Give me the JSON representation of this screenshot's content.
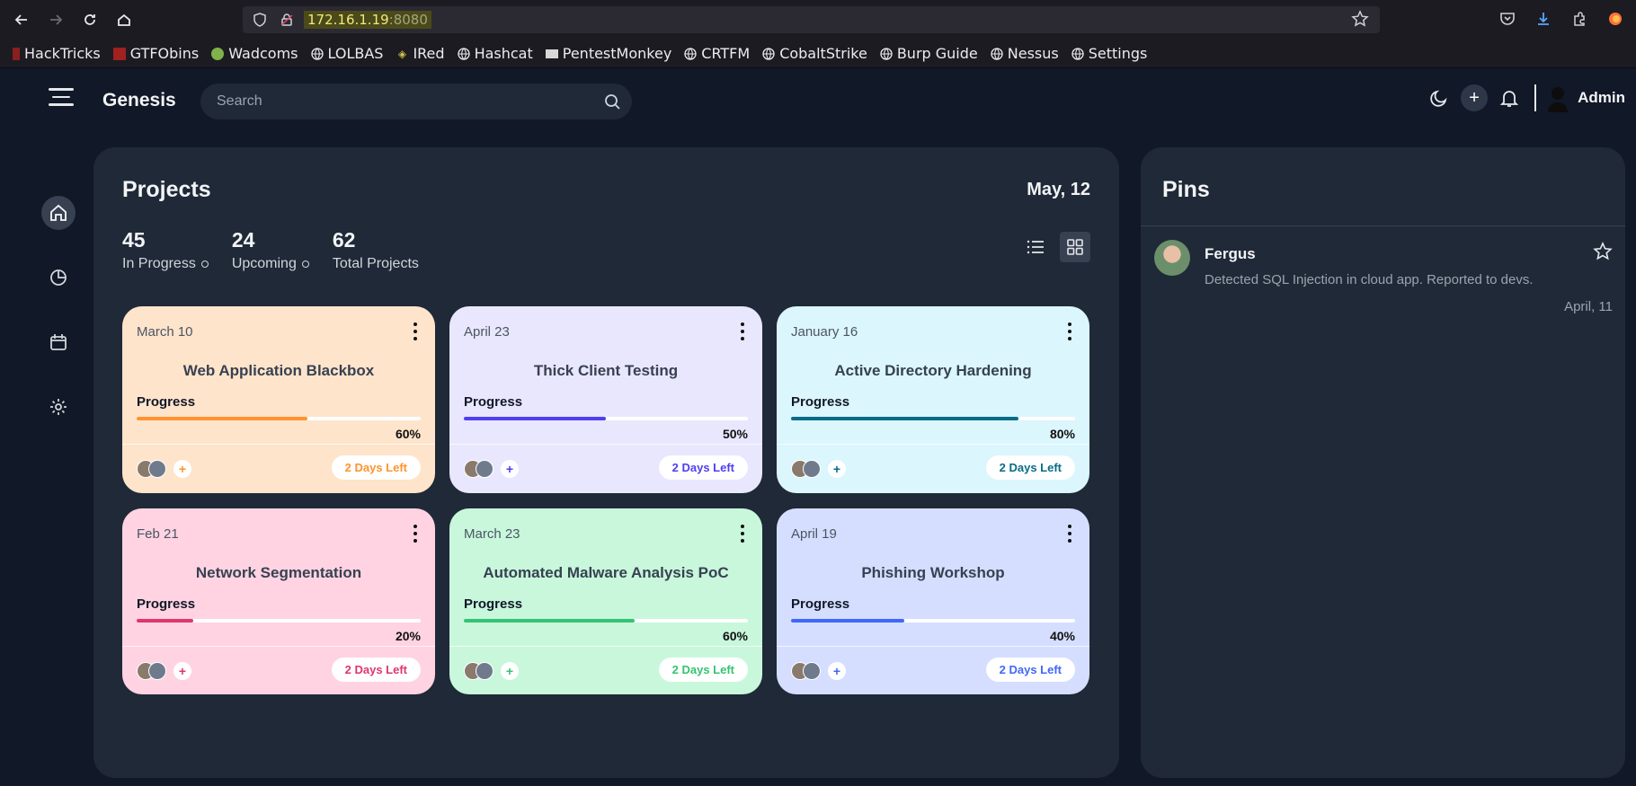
{
  "browser": {
    "url_host": "172.16.1.19",
    "url_port": ":8080",
    "bookmarks": [
      "HackTricks",
      "GTFObins",
      "Wadcoms",
      "LOLBAS",
      "IRed",
      "Hashcat",
      "PentestMonkey",
      "CRTFM",
      "CobaltStrike",
      "Burp Guide",
      "Nessus",
      "Settings"
    ]
  },
  "app": {
    "brand": "Genesis",
    "search_placeholder": "Search",
    "user": "Admin"
  },
  "projects": {
    "title": "Projects",
    "date": "May, 12",
    "stats": [
      {
        "num": "45",
        "label": "In Progress"
      },
      {
        "num": "24",
        "label": "Upcoming"
      },
      {
        "num": "62",
        "label": "Total Projects"
      }
    ],
    "cards": [
      {
        "date": "March 10",
        "name": "Web Application Blackbox",
        "progress_label": "Progress",
        "percent": "60%",
        "progress": 0.6,
        "days_left": "2 Days Left",
        "bg": "#fee4cb",
        "accent": "#ff942e"
      },
      {
        "date": "April 23",
        "name": "Thick Client Testing",
        "progress_label": "Progress",
        "percent": "50%",
        "progress": 0.5,
        "days_left": "2 Days Left",
        "bg": "#e9e7fd",
        "accent": "#4f3ff0"
      },
      {
        "date": "January 16",
        "name": "Active Directory Hardening",
        "progress_label": "Progress",
        "percent": "80%",
        "progress": 0.8,
        "days_left": "2 Days Left",
        "bg": "#dbf6fd",
        "accent": "#096c86"
      },
      {
        "date": "Feb 21",
        "name": "Network Segmentation",
        "progress_label": "Progress",
        "percent": "20%",
        "progress": 0.2,
        "days_left": "2 Days Left",
        "bg": "#ffd3e2",
        "accent": "#df3670"
      },
      {
        "date": "March 23",
        "name": "Automated Malware Analysis PoC",
        "progress_label": "Progress",
        "percent": "60%",
        "progress": 0.6,
        "days_left": "2 Days Left",
        "bg": "#c8f7dc",
        "accent": "#34c471"
      },
      {
        "date": "April 19",
        "name": "Phishing Workshop",
        "progress_label": "Progress",
        "percent": "40%",
        "progress": 0.4,
        "days_left": "2 Days Left",
        "bg": "#d5deff",
        "accent": "#4067f9"
      }
    ]
  },
  "pins": {
    "title": "Pins",
    "items": [
      {
        "name": "Fergus",
        "text": "Detected SQL Injection in cloud app. Reported to devs.",
        "date": "April, 11"
      }
    ]
  }
}
